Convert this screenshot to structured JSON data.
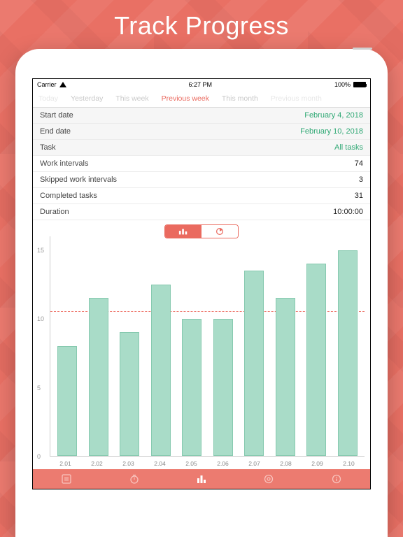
{
  "hero_title": "Track Progress",
  "statusbar": {
    "carrier": "Carrier",
    "time": "6:27 PM",
    "battery": "100%"
  },
  "period_tabs": {
    "items": [
      "Today",
      "Yesterday",
      "This week",
      "Previous week",
      "This month",
      "Previous month"
    ],
    "active_index": 3
  },
  "filters": {
    "start_date": {
      "label": "Start date",
      "value": "February 4, 2018"
    },
    "end_date": {
      "label": "End date",
      "value": "February 10, 2018"
    },
    "task": {
      "label": "Task",
      "value": "All tasks"
    }
  },
  "stats": {
    "work_intervals": {
      "label": "Work intervals",
      "value": "74"
    },
    "skipped_work_intervals": {
      "label": "Skipped work intervals",
      "value": "3"
    },
    "completed_tasks": {
      "label": "Completed tasks",
      "value": "31"
    },
    "duration": {
      "label": "Duration",
      "value": "10:00:00"
    }
  },
  "chart_toggle": {
    "options": [
      "bar",
      "pie"
    ],
    "active": "bar"
  },
  "chart_data": {
    "type": "bar",
    "title": "",
    "xlabel": "",
    "ylabel": "",
    "ylim": [
      0,
      16
    ],
    "y_ticks": [
      0,
      5,
      10,
      15
    ],
    "average_line": 10.5,
    "categories": [
      "2.01",
      "2.02",
      "2.03",
      "2.04",
      "2.05",
      "2.06",
      "2.07",
      "2.08",
      "2.09",
      "2.10"
    ],
    "values": [
      8,
      11.5,
      9,
      12.5,
      10,
      10,
      13.5,
      11.5,
      14,
      15
    ]
  },
  "tabbar": {
    "items": [
      "list-icon",
      "timer-icon",
      "stats-icon",
      "settings-icon",
      "info-icon"
    ],
    "active_index": 2
  },
  "colors": {
    "accent": "#ea6a5f",
    "bar_fill": "#a9dcc8",
    "bar_stroke": "#86c9af",
    "green_text": "#2fa874"
  }
}
